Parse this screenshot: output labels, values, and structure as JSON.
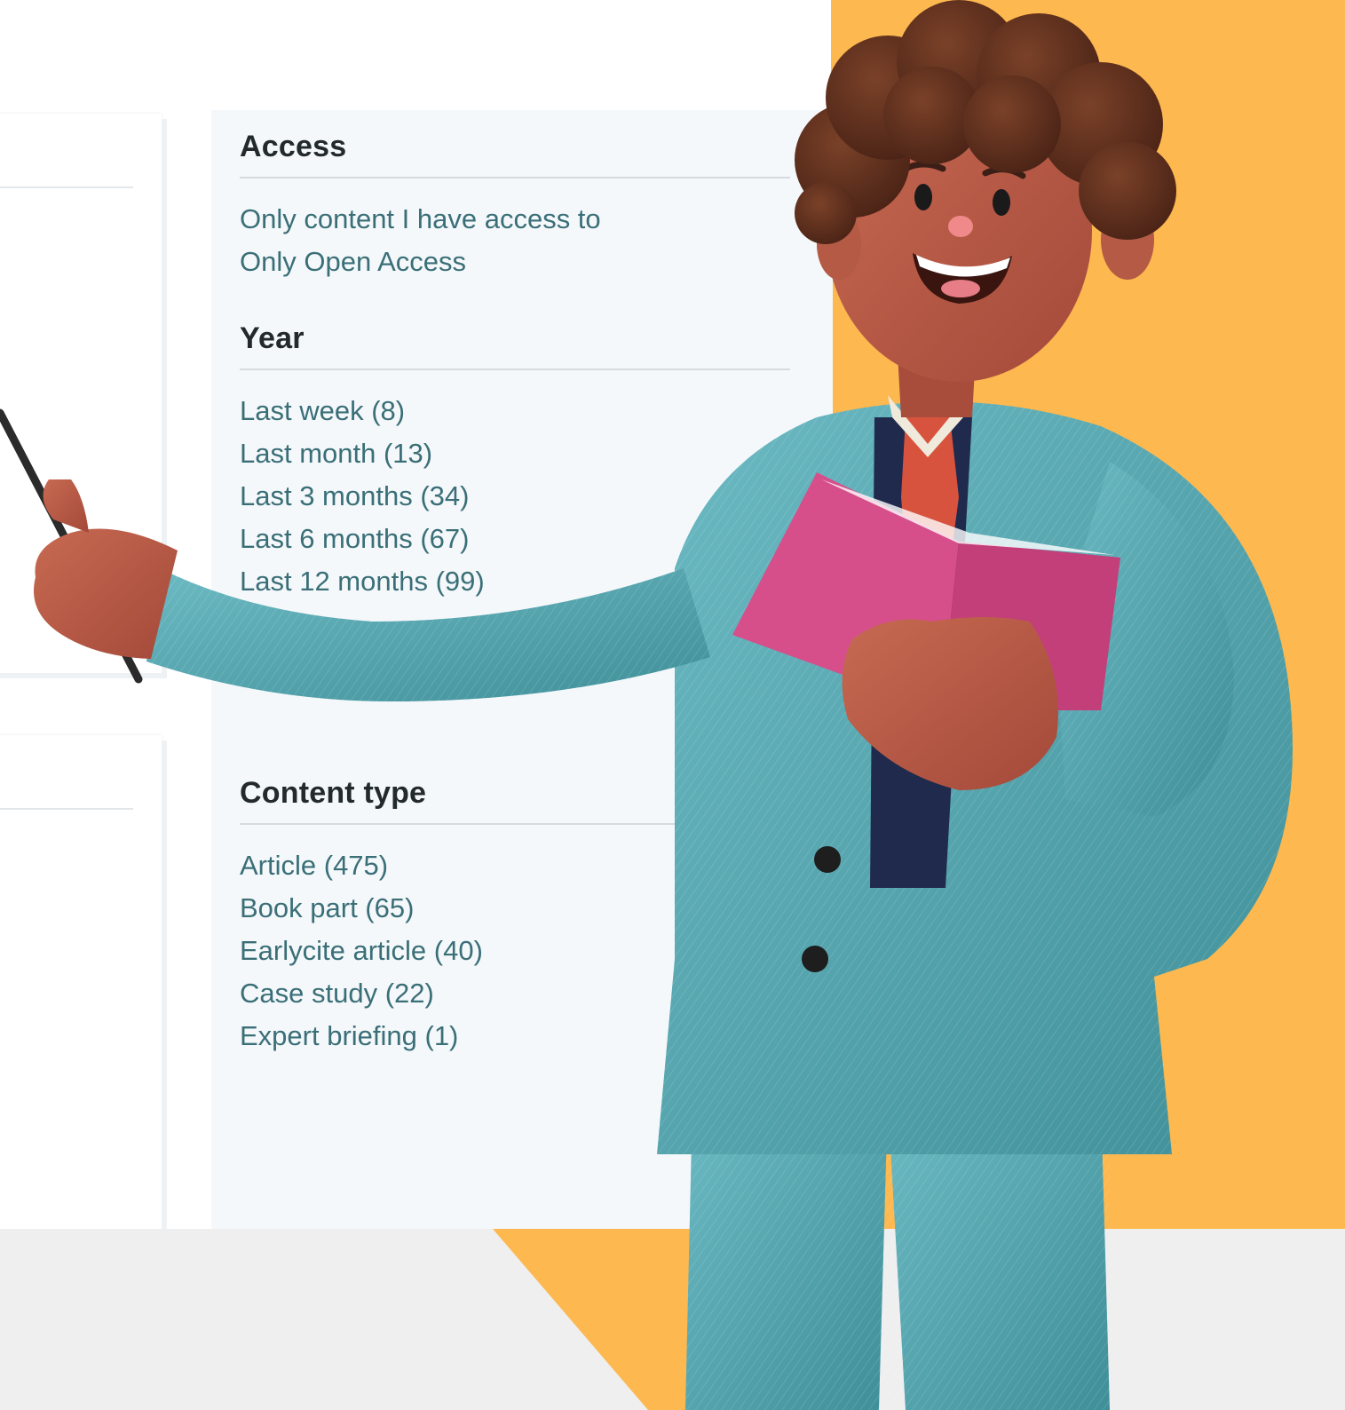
{
  "filters": {
    "access": {
      "heading": "Access",
      "items": [
        "Only content I have access to",
        "Only Open Access"
      ]
    },
    "year": {
      "heading": "Year",
      "items": [
        "Last week (8)",
        "Last month (13)",
        "Last 3 months (34)",
        "Last 6 months (67)",
        "Last 12 months (99)"
      ]
    },
    "content_type": {
      "heading": "Content type",
      "items": [
        "Article (475)",
        "Book part (65)",
        "Earlycite article (40)",
        "Case study (22)",
        "Expert briefing (1)"
      ]
    }
  },
  "colors": {
    "accent_orange": "#fdb84f",
    "link_teal": "#3a6f78",
    "panel_bg": "#f5f8fa",
    "suit_teal": "#5aa9b3",
    "book_pink": "#d64f8b"
  },
  "icons": {
    "illustration": "teacher-character-illustration"
  }
}
